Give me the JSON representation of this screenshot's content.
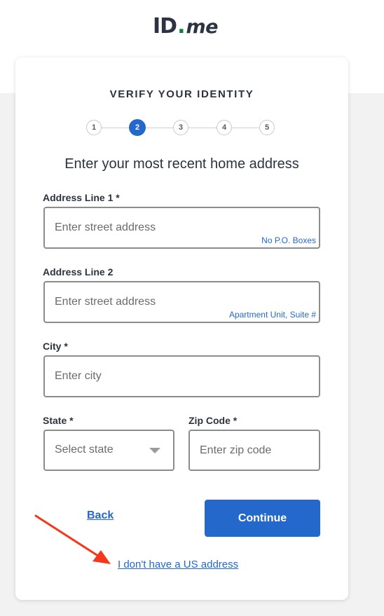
{
  "brand": {
    "logo_id": "ID",
    "logo_dot": ".",
    "logo_me": "me"
  },
  "page": {
    "title": "VERIFY YOUR IDENTITY"
  },
  "stepper": {
    "steps": [
      "1",
      "2",
      "3",
      "4",
      "5"
    ],
    "active_step": 2
  },
  "form": {
    "heading": "Enter your most recent home address",
    "address1": {
      "label": "Address Line 1 *",
      "placeholder": "Enter street address",
      "hint": "No P.O. Boxes",
      "value": ""
    },
    "address2": {
      "label": "Address Line 2",
      "placeholder": "Enter street address",
      "hint": "Apartment Unit, Suite #",
      "value": ""
    },
    "city": {
      "label": "City *",
      "placeholder": "Enter city",
      "value": ""
    },
    "state": {
      "label": "State *",
      "selected": "Select state"
    },
    "zip": {
      "label": "Zip Code *",
      "placeholder": "Enter zip code",
      "value": ""
    }
  },
  "actions": {
    "back_label": "Back",
    "continue_label": "Continue",
    "no_us_address_label": "I don't have a US address"
  },
  "colors": {
    "accent": "#2468cc",
    "annotation_arrow": "#f5381c",
    "logo_dot": "#08833d"
  }
}
